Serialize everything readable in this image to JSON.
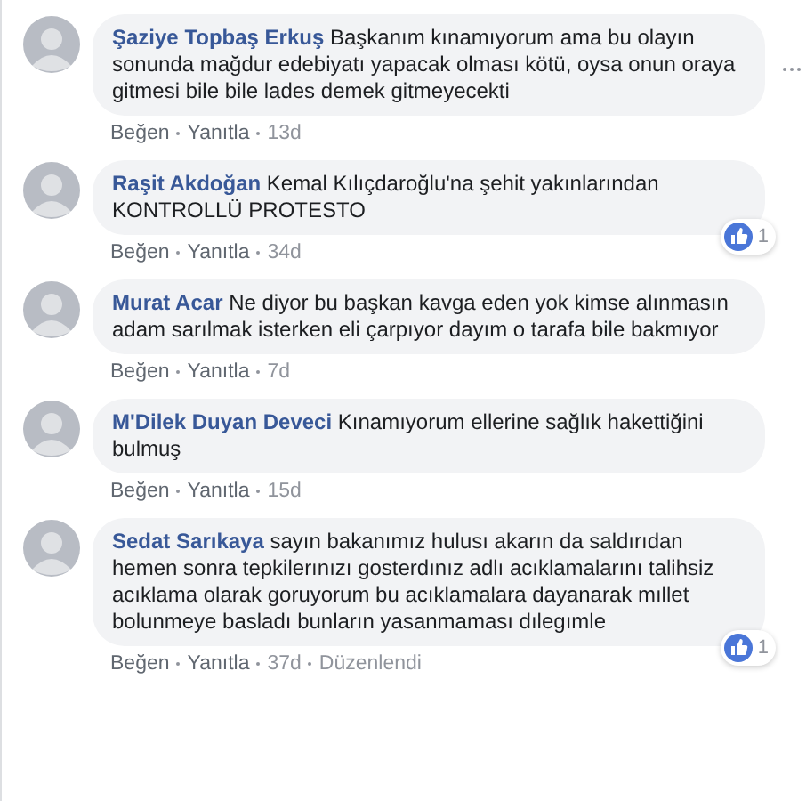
{
  "comments": [
    {
      "author": "Şaziye Topbaş Erkuş",
      "text": "Başkanım kınamıyorum ama bu olayın sonunda mağdur edebiyatı yapacak olması kötü, oysa onun oraya gitmesi bile bile lades demek gitmeyecekti",
      "like": "Beğen",
      "reply": "Yanıtla",
      "time": "13d",
      "menu": true
    },
    {
      "author": "Raşit Akdoğan",
      "text": "Kemal Kılıçdaroğlu'na şehit yakınlarından KONTROLLÜ PROTESTO",
      "like": "Beğen",
      "reply": "Yanıtla",
      "time": "34d",
      "reactions": "1"
    },
    {
      "author": "Murat Acar",
      "text": "Ne diyor bu başkan kavga eden yok kimse alınmasın adam sarılmak isterken eli çarpıyor dayım o tarafa bile bakmıyor",
      "like": "Beğen",
      "reply": "Yanıtla",
      "time": "7d"
    },
    {
      "author": "M'Dilek Duyan Deveci",
      "text": "Kınamıyorum ellerine sağlık hakettiğini bulmuş",
      "like": "Beğen",
      "reply": "Yanıtla",
      "time": "15d"
    },
    {
      "author": "Sedat Sarıkaya",
      "text": "sayın bakanımız hulusı akarın da saldırıdan hemen sonra tepkilerınızı gosterdınız adlı acıklamalarını talihsiz acıklama olarak goruyorum bu acıklamalara dayanarak mıllet bolunmeye basladı bunların yasanmaması dılegımle",
      "like": "Beğen",
      "reply": "Yanıtla",
      "time": "37d",
      "edited": "Düzenlendi",
      "reactions": "1"
    }
  ]
}
